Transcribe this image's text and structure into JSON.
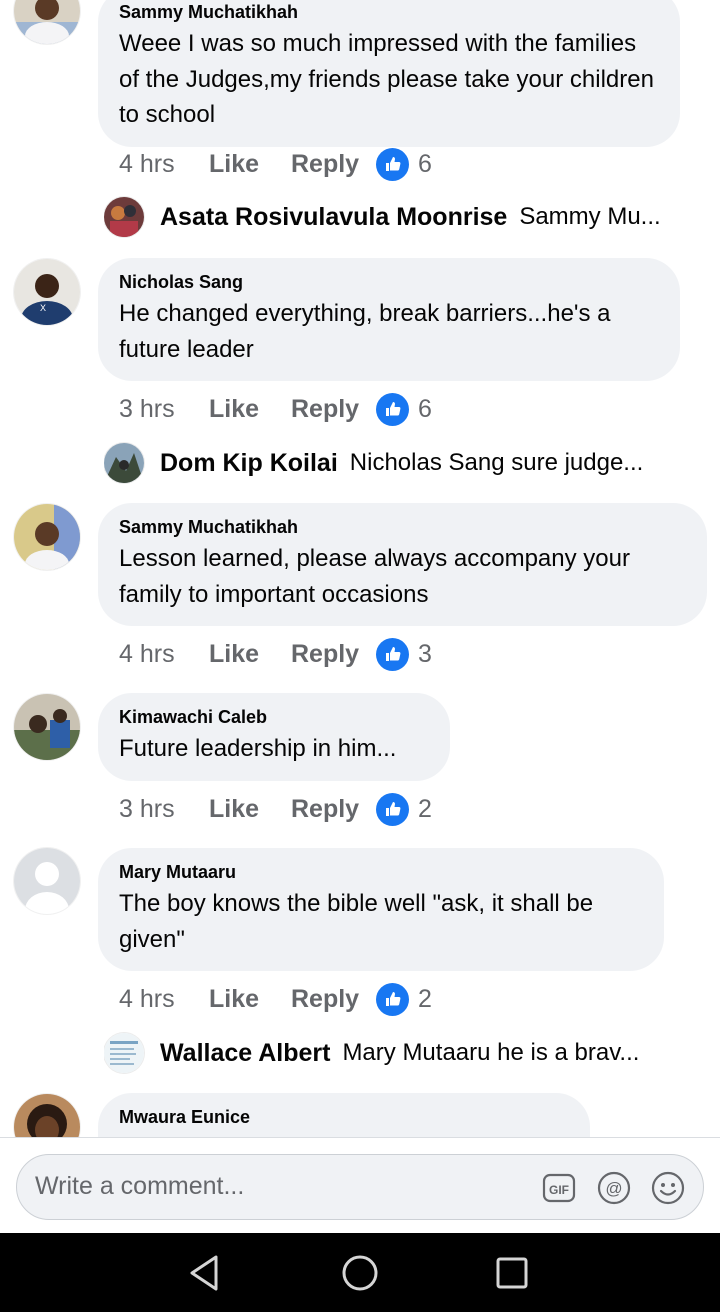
{
  "comments": [
    {
      "name": "Sammy Muchatikhah",
      "text": "Weee I was so much impressed with the families of the Judges,my friends please take your children to school",
      "time": "4 hrs",
      "like": "Like",
      "reply": "Reply",
      "reactions": "6",
      "reply_preview": {
        "name": "Asata Rosivulavula Moonrise",
        "text": "Sammy Mu..."
      }
    },
    {
      "name": "Nicholas Sang",
      "text": "He changed everything, break barriers...he's a future leader",
      "time": "3 hrs",
      "like": "Like",
      "reply": "Reply",
      "reactions": "6",
      "reply_preview": {
        "name": "Dom Kip Koilai",
        "text": "Nicholas Sang sure judge..."
      }
    },
    {
      "name": "Sammy Muchatikhah",
      "text": "Lesson learned, please always accompany your family to important occasions",
      "time": "4 hrs",
      "like": "Like",
      "reply": "Reply",
      "reactions": "3"
    },
    {
      "name": "Kimawachi Caleb",
      "text": "Future leadership in him...",
      "time": "3 hrs",
      "like": "Like",
      "reply": "Reply",
      "reactions": "2"
    },
    {
      "name": "Mary Mutaaru",
      "text": "The boy knows the bible well \"ask, it shall be given\"",
      "time": "4 hrs",
      "like": "Like",
      "reply": "Reply",
      "reactions": "2",
      "reply_preview": {
        "name": "Wallace Albert",
        "text": "Mary Mutaaru he is a brav..."
      }
    },
    {
      "name": "Mwaura Eunice"
    }
  ],
  "composer": {
    "placeholder": "Write a comment...",
    "gif_label": "GIF",
    "mention_label": "@"
  },
  "colors": {
    "accent": "#1877f2",
    "bubble": "#f0f2f5",
    "meta": "#65676b"
  },
  "icons": [
    "like-thumb-icon",
    "gif-icon",
    "mention-icon",
    "emoji-icon",
    "back-icon",
    "home-icon",
    "recents-icon"
  ]
}
